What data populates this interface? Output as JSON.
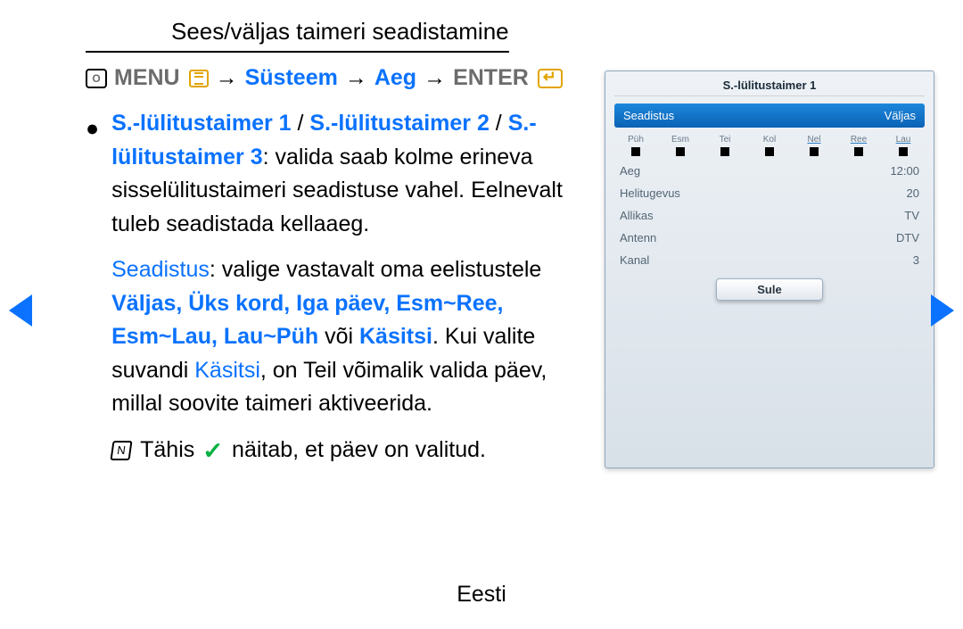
{
  "title": "Sees/väljas taimeri seadistamine",
  "nav": {
    "menu_label": "MENU",
    "path1": "Süsteem",
    "path2": "Aeg",
    "enter_label": "ENTER",
    "arrow": "→"
  },
  "text": {
    "timer1": "S.-lülitustaimer 1",
    "timer2": "S.-lülitustaimer 2",
    "timer3": "S.-lülitustaimer 3",
    "slash": " / ",
    "sentence1_tail": ": valida saab kolme erineva sisselülitustaimeri seadistuse vahel. Eelnevalt tuleb seadistada kellaaeg.",
    "seadistus_label": "Seadistus",
    "sentence2_tail": ": valige vastavalt oma eelistustele ",
    "options1": "Väljas, Üks kord, Iga päev, Esm~Ree, Esm~Lau, Lau~Püh",
    "voi": " või ",
    "kasitsi": "Käsitsi",
    "sentence2_end": ". Kui valite suvandi ",
    "sentence2_end2": ", on Teil võimalik valida päev, millal soovite taimeri aktiveerida.",
    "note_pre": "Tähis",
    "note_post": "näitab, et päev on valitud."
  },
  "panel": {
    "title": "S.-lülitustaimer 1",
    "hl_left": "Seadistus",
    "hl_right": "Väljas",
    "days": [
      "Püh",
      "Esm",
      "Tei",
      "Kol",
      "Nel",
      "Ree",
      "Lau"
    ],
    "days_underlined": [
      "Nel",
      "Ree",
      "Lau"
    ],
    "rows": [
      {
        "label": "Aeg",
        "value": "12:00"
      },
      {
        "label": "Helitugevus",
        "value": "20"
      },
      {
        "label": "Allikas",
        "value": "TV"
      },
      {
        "label": "Antenn",
        "value": "DTV"
      },
      {
        "label": "Kanal",
        "value": "3"
      }
    ],
    "close": "Sule"
  },
  "footer": "Eesti"
}
